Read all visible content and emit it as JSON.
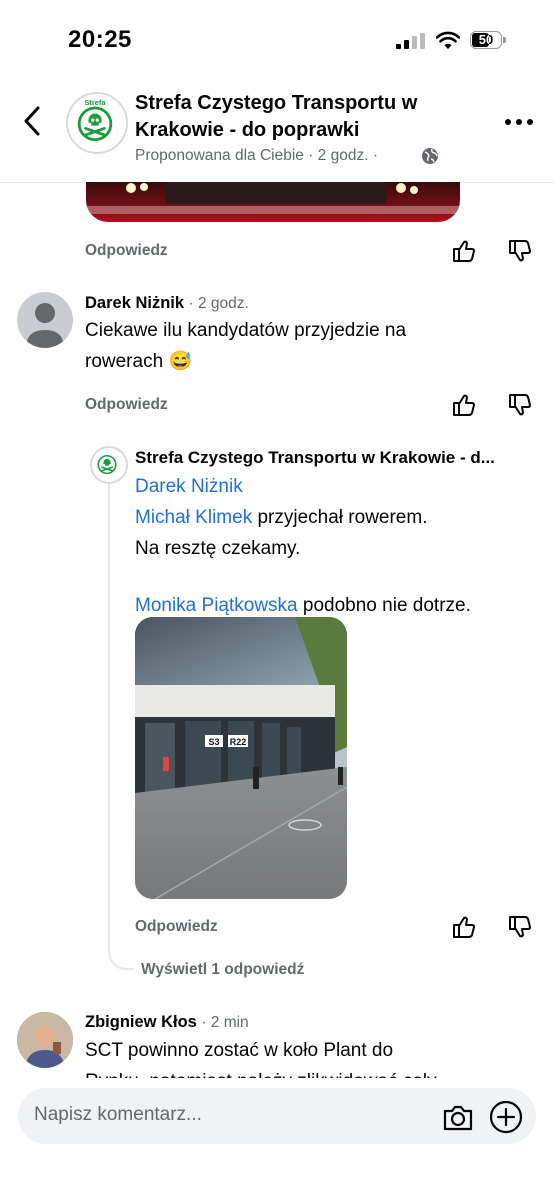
{
  "status": {
    "time": "20:25",
    "battery": "50"
  },
  "header": {
    "logo_text": "Strefa",
    "title": "Strefa Czystego Transportu w Krakowie - do poprawki",
    "subtitle": "Proponowana dla Ciebie · 2 godz. ·"
  },
  "actions": {
    "reply": "Odpowiedz"
  },
  "comments": [
    {
      "author": "Darek Niżnik",
      "time": "· 2 godz.",
      "text_line1": "Ciekawe ilu kandydatów przyjedzie na",
      "text_line2": "rowerach",
      "emoji": "😅"
    },
    {
      "author": "Strefa Czystego Transportu w Krakowie - d...",
      "mention1": "Darek Niżnik",
      "mention2": "Michał Klimek",
      "text_after_mention2": " przyjechał rowerem.",
      "line3": "Na resztę czekamy.",
      "mention3": "Monika Piątkowska",
      "text_after_mention3": " podobno nie dotrze.",
      "photo_sign1": "S3",
      "photo_sign2": "R22",
      "view_replies": "Wyświetl 1 odpowiedź"
    },
    {
      "author": "Zbigniew Kłos",
      "time": "· 2 min",
      "text_line1": "SCT powinno zostać w koło Plant do",
      "text_line2": "Rynku, natomiast należy zlikwidować cały"
    }
  ],
  "composer": {
    "placeholder": "Napisz komentarz..."
  },
  "colors": {
    "link": "#216fdb",
    "secondary": "#65676b",
    "logo_green": "#1a9b3c"
  }
}
